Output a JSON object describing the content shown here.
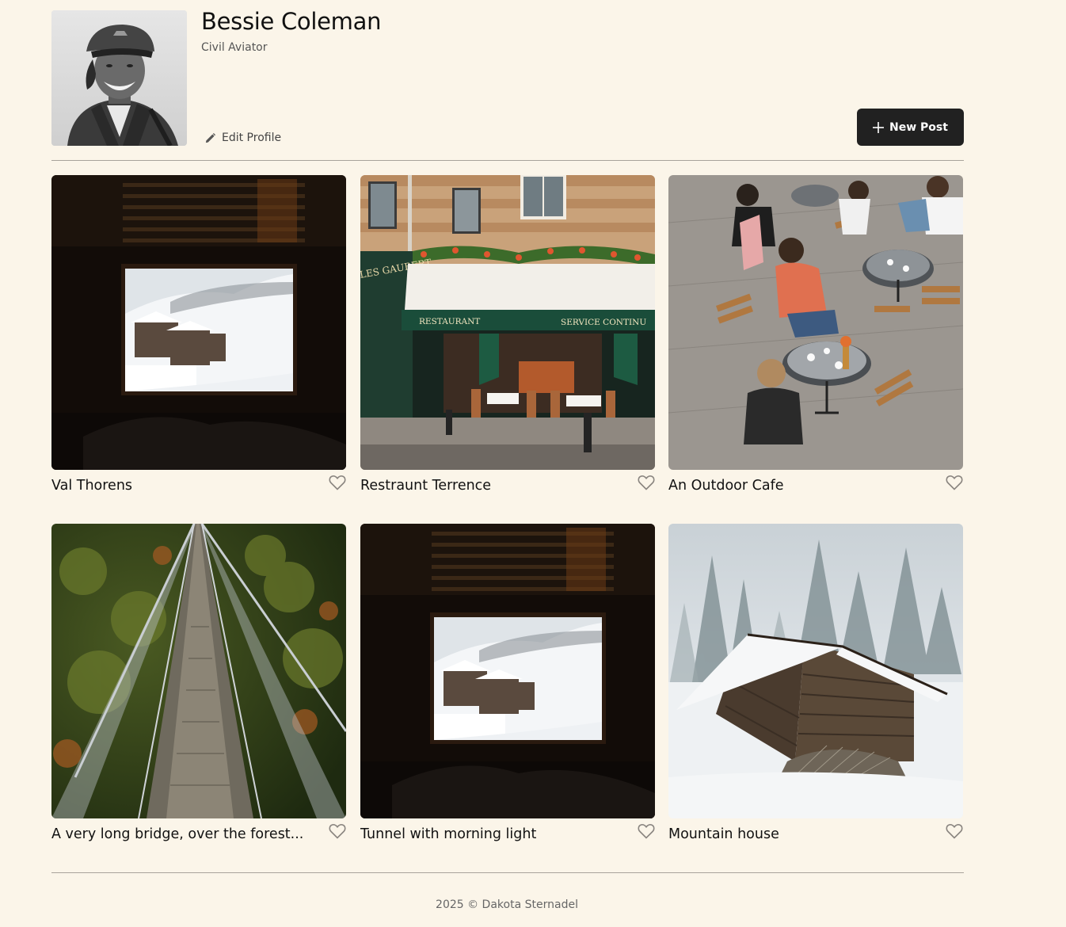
{
  "profile": {
    "name": "Bessie Coleman",
    "title": "Civil Aviator",
    "edit_label": "Edit Profile",
    "avatar_icon": "avatar-photo"
  },
  "actions": {
    "new_post_label": "New Post",
    "new_post_icon": "plus-icon"
  },
  "cards": [
    {
      "title": "Val Thorens",
      "image": "window-snowy-resort",
      "liked": false
    },
    {
      "title": "Restraunt Terrence",
      "image": "restaurant-storefront",
      "liked": false
    },
    {
      "title": "An Outdoor Cafe",
      "image": "outdoor-cafe",
      "liked": false
    },
    {
      "title": "A very long bridge, over the forest...",
      "image": "suspension-bridge-forest",
      "liked": false
    },
    {
      "title": "Tunnel with morning light",
      "image": "window-snowy-resort",
      "liked": false
    },
    {
      "title": "Mountain house",
      "image": "snowy-wooden-cabin",
      "liked": false
    }
  ],
  "storefront_signs": {
    "left": "RESTAURANT",
    "right": "SERVICE CONTINU",
    "awning_side": "LES GAUBERT"
  },
  "footer": {
    "copyright": "2025 © Dakota Sternadel"
  },
  "colors": {
    "background": "#fbf5e9",
    "button": "#212121",
    "divider": "#a8a39b",
    "text": "#111111",
    "muted": "#555555"
  }
}
